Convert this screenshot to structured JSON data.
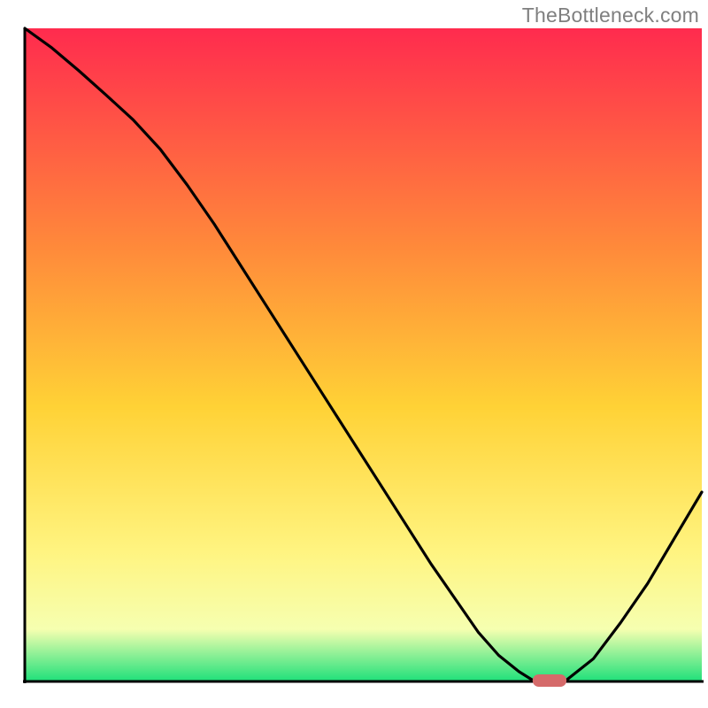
{
  "watermark": "TheBottleneck.com",
  "colors": {
    "curve": "#000000",
    "marker": "#d56a6a",
    "axis": "#000000",
    "grad_top": "#ff2b4e",
    "grad_mid_upper": "#ff8b3a",
    "grad_mid": "#ffd236",
    "grad_mid_lower": "#fff480",
    "grad_low": "#f6ffb0",
    "grad_bottom": "#1ee07a"
  },
  "chart_data": {
    "type": "line",
    "title": "",
    "xlabel": "",
    "ylabel": "",
    "xlim": [
      0,
      100
    ],
    "ylim": [
      0,
      100
    ],
    "x": [
      0,
      4,
      8,
      12,
      16,
      20,
      24,
      28,
      32,
      36,
      40,
      44,
      48,
      52,
      56,
      60,
      64,
      67,
      70,
      73,
      75,
      78,
      80,
      84,
      88,
      92,
      96,
      100
    ],
    "y": [
      100,
      97,
      93.5,
      89.8,
      86,
      81.5,
      76,
      70,
      63.5,
      57,
      50.5,
      44,
      37.5,
      31,
      24.5,
      18,
      12,
      7.5,
      4,
      1.5,
      0.2,
      0,
      0.2,
      3.5,
      9,
      15,
      22,
      29
    ],
    "marker": {
      "x_start": 75,
      "x_end": 80,
      "y": 0
    },
    "notes": "V-shaped bottleneck curve over vertical heat gradient; minimum near x≈77"
  }
}
